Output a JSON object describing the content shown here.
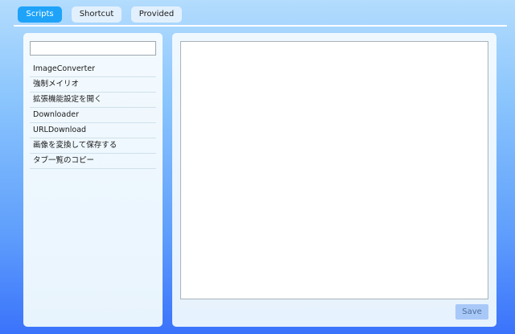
{
  "tabs": [
    {
      "label": "Scripts",
      "active": true
    },
    {
      "label": "Shortcut",
      "active": false
    },
    {
      "label": "Provided",
      "active": false
    }
  ],
  "sidebar": {
    "filter": {
      "value": "",
      "placeholder": ""
    },
    "items": [
      {
        "label": "ImageConverter"
      },
      {
        "label": "強制メイリオ"
      },
      {
        "label": "拡張機能設定を開く"
      },
      {
        "label": "Downloader"
      },
      {
        "label": "URLDownload"
      },
      {
        "label": "画像を変換して保存する"
      },
      {
        "label": "タブ一覧のコピー"
      }
    ]
  },
  "editor": {
    "content": ""
  },
  "actions": {
    "save_label": "Save"
  },
  "colors": {
    "active_tab": "#1ea3f9",
    "inactive_tab": "#e2f0fd",
    "save_button_bg": "#a8c8f8",
    "save_button_text": "#4f6f9e"
  }
}
